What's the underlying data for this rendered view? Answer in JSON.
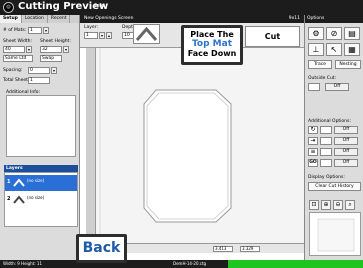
{
  "app": {
    "title": "Cutting Preview",
    "menu_info": "Info"
  },
  "left_panel": {
    "tabs": [
      {
        "label": "Setup"
      },
      {
        "label": "Location"
      },
      {
        "label": "Recent"
      }
    ],
    "num_mats_label": "# of Mats:",
    "num_mats_value": "1",
    "sheet_width_label": "Sheet Width:",
    "sheet_height_label": "Sheet Height:",
    "sheet_width_value": "40",
    "sheet_height_value": "32",
    "orient_select": "Same Ltd",
    "swap_button": "Swap",
    "spacing_label": "Spacing:",
    "spacing_value": "0",
    "total_sheets_label": "Total Sheets:",
    "total_sheets_value": "1",
    "additional_info_label": "Additional Info:",
    "layers_header": "Layers",
    "layers": [
      {
        "num": "1",
        "label": "(no size)"
      },
      {
        "num": "2",
        "label": "(no size)"
      }
    ]
  },
  "center": {
    "header": "New Openings Screen",
    "zoom_text": "9x11",
    "layer_label": "Layer:",
    "layer_value": "1",
    "depth_label": "Depth:",
    "depth_value": "10",
    "coord_x": "3.413",
    "coord_y": "3.329"
  },
  "instruction": {
    "line1": "Place The",
    "line2": "Top  Mat",
    "line3": "Face Down"
  },
  "cut_button": "Cut",
  "back_button": "Back",
  "right_panel": {
    "header": "Options",
    "trace_button": "Trace",
    "nesting_button": "Nesting",
    "outside_cut_label": "Outside Cut:",
    "off_label": "Off",
    "additional_options_label": "Additional Options:",
    "additional_options": [
      {
        "icon": "rotate-icon",
        "glyph": "↻",
        "state": "Off"
      },
      {
        "icon": "split-icon",
        "glyph": "⇥",
        "state": "Off"
      },
      {
        "icon": "lines-icon",
        "glyph": "≡",
        "state": "Off"
      },
      {
        "icon": "go-icon",
        "glyph": "GO",
        "state": "Off"
      }
    ],
    "display_options_label": "Display Options:",
    "clear_cut_history": "Clear Cut History"
  },
  "status": {
    "left": "Width: 9  Height: 11",
    "center": "DemH-14-20.ctg"
  },
  "colors": {
    "accent": "#1b4f9c",
    "callout_blue": "#2a74c9",
    "status_green": "#1fc51f"
  }
}
